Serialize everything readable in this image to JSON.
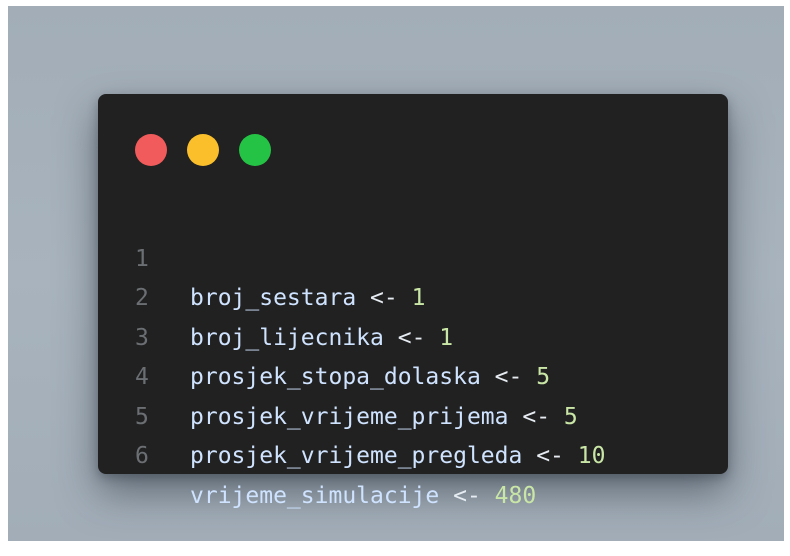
{
  "colors": {
    "window_bg": "#212121",
    "backdrop": "#a6b1bb",
    "dot_red": "#f25b5b",
    "dot_yellow": "#fbbf2b",
    "dot_green": "#25c345",
    "identifier": "#cfe3ff",
    "operator": "#e6ecf2",
    "number": "#c9e6a6",
    "line_number": "#6b6f73"
  },
  "window_controls": [
    {
      "name": "close",
      "color": "#f25b5b"
    },
    {
      "name": "minimize",
      "color": "#fbbf2b"
    },
    {
      "name": "maximize",
      "color": "#25c345"
    }
  ],
  "code_lines": [
    {
      "number": "1",
      "identifier": "broj_sestara",
      "operator": "<-",
      "value": "1"
    },
    {
      "number": "2",
      "identifier": "broj_lijecnika",
      "operator": "<-",
      "value": "1"
    },
    {
      "number": "3",
      "identifier": "prosjek_stopa_dolaska",
      "operator": "<-",
      "value": "5"
    },
    {
      "number": "4",
      "identifier": "prosjek_vrijeme_prijema",
      "operator": "<-",
      "value": "5"
    },
    {
      "number": "5",
      "identifier": "prosjek_vrijeme_pregleda",
      "operator": "<-",
      "value": "10"
    },
    {
      "number": "6",
      "identifier": "vrijeme_simulacije",
      "operator": "<-",
      "value": "480"
    }
  ]
}
